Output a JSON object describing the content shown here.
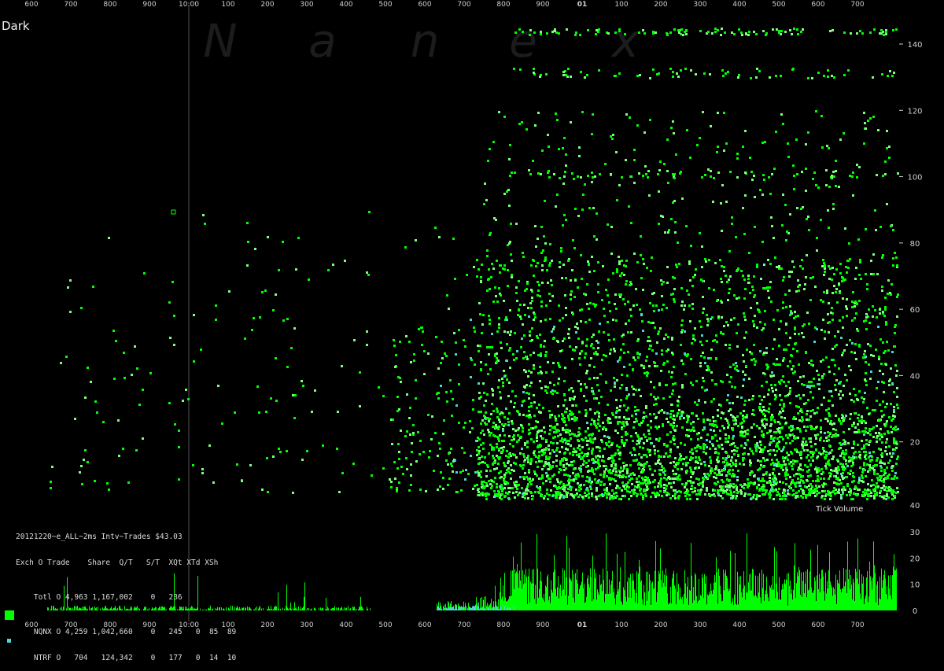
{
  "title": "Dark",
  "watermark": "N a n e x",
  "tick_volume_label": "Tick Volume",
  "stats": {
    "header": "20121220~e_ALL~2ms Intv~Trades $43.03",
    "columns": "Exch O Trade    Share  Q/T   S/T  XQt XTd XSh",
    "rows": [
      {
        "text": "Totl O 4,963 1,167,002    0   236",
        "color": "",
        "swatch": "none"
      },
      {
        "text": "NQNX O 4,259 1,042,660    0   245   0  85  89",
        "color": "#00ff00",
        "swatch": "large"
      },
      {
        "text": "NTRF O   704   124,342    0   177   0  14  10",
        "color": "#4fd3d3",
        "swatch": "small"
      }
    ]
  },
  "colors": {
    "background": "#000000",
    "nqnx": "#00ff00",
    "nqnx_light": "#7dff7d",
    "ntrf": "#4fd3d3",
    "axis_text": "#d0d0d0",
    "watermark": "#1c1c1c",
    "grid": "#2a2a2a",
    "cursor": "#555555"
  },
  "chart_data": [
    {
      "type": "scatter",
      "title": "Dark",
      "xlabel": "",
      "ylabel": "",
      "x_tick_labels": [
        "600",
        "700",
        "800",
        "900",
        "10:00",
        "100",
        "200",
        "300",
        "400",
        "500",
        "600",
        "700",
        "800",
        "900",
        "01",
        "100",
        "200",
        "300",
        "400",
        "500",
        "600",
        "700"
      ],
      "y_ticks": [
        140,
        120,
        100,
        80,
        60,
        40,
        20
      ],
      "y_tick_labels": [
        "140",
        "120",
        "100",
        "80",
        "60",
        "40",
        "20",
        "40"
      ],
      "ylim": [
        0,
        150
      ],
      "grid": true,
      "series": [
        {
          "name": "NQNX",
          "color": "#00ff00",
          "clusters": [
            {
              "x": [
                200,
                5680
              ],
              "y": [
                5,
                90
              ],
              "n": 180
            },
            {
              "x": [
                4600,
                5680
              ],
              "y": [
                5,
                55
              ],
              "n": 120
            },
            {
              "x": [
                5700,
                11100
              ],
              "y": [
                3,
                75
              ],
              "n": 2400
            },
            {
              "x": [
                5700,
                11100
              ],
              "y": [
                4,
                30
              ],
              "n": 1500
            },
            {
              "x": [
                5700,
                11100
              ],
              "y": [
                75,
                120
              ],
              "n": 300
            },
            {
              "x": [
                6000,
                11100
              ],
              "y": [
                100,
                102
              ],
              "n": 60
            },
            {
              "x": [
                6000,
                11100
              ],
              "y": [
                130,
                133
              ],
              "n": 70
            },
            {
              "x": [
                6100,
                11100
              ],
              "y": [
                143,
                145
              ],
              "n": 110
            }
          ]
        },
        {
          "name": "NTRF",
          "color": "#4fd3d3",
          "clusters": [
            {
              "x": [
                5200,
                11100
              ],
              "y": [
                3,
                60
              ],
              "n": 160
            }
          ]
        }
      ]
    },
    {
      "type": "bar",
      "title": "Tick Volume",
      "y_ticks": [
        0,
        10,
        20,
        30
      ],
      "ylim": [
        0,
        32
      ],
      "x_tick_labels": [
        "600",
        "700",
        "800",
        "900",
        "10:00",
        "100",
        "200",
        "300",
        "400",
        "500",
        "600",
        "700",
        "800",
        "900",
        "01",
        "100",
        "200",
        "300",
        "400",
        "500",
        "600",
        "700"
      ],
      "series": [
        {
          "name": "NQNX",
          "color": "#00ff00",
          "segments": [
            {
              "x": [
                200,
                4350
              ],
              "mean": 1,
              "spike": 15,
              "spike_rate": 0.04
            },
            {
              "x": [
                5200,
                5680
              ],
              "mean": 2,
              "spike": 8,
              "spike_rate": 0.05
            },
            {
              "x": [
                5700,
                6000
              ],
              "mean": 3,
              "spike": 10,
              "spike_rate": 0.1
            },
            {
              "x": [
                6000,
                11100
              ],
              "mean": 9,
              "spike": 30,
              "spike_rate": 0.12
            }
          ]
        },
        {
          "name": "NTRF",
          "color": "#4fd3d3",
          "segments": [
            {
              "x": [
                5200,
                6200
              ],
              "mean": 1,
              "spike": 4,
              "spike_rate": 0.05
            }
          ]
        }
      ]
    }
  ]
}
